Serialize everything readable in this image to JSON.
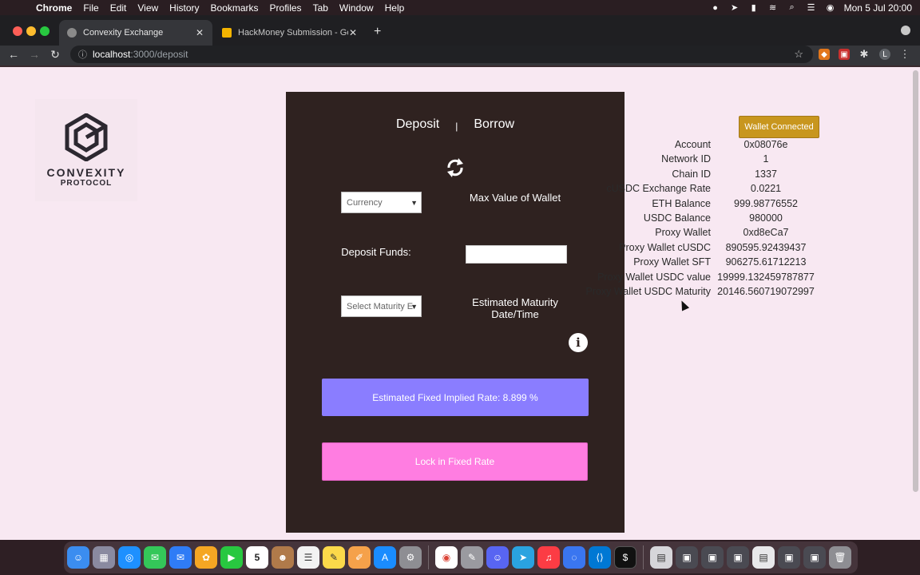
{
  "menubar": {
    "app": "Chrome",
    "items": [
      "File",
      "Edit",
      "View",
      "History",
      "Bookmarks",
      "Profiles",
      "Tab",
      "Window",
      "Help"
    ],
    "clock": "Mon 5 Jul  20:00"
  },
  "tabs": [
    {
      "title": "Convexity Exchange",
      "active": true
    },
    {
      "title": "HackMoney Submission - Goo",
      "active": false
    }
  ],
  "address": {
    "host": "localhost",
    "path": ":3000/deposit"
  },
  "logo": {
    "line1": "CONVEXITY",
    "line2": "PROTOCOL"
  },
  "panel": {
    "mode_deposit": "Deposit",
    "mode_sep": "|",
    "mode_borrow": "Borrow",
    "currency_select": "Currency",
    "max_value_label": "Max Value of Wallet",
    "deposit_funds_label": "Deposit Funds:",
    "deposit_input": "",
    "maturity_select": "Select Maturity E",
    "est_maturity_label_1": "Estimated Maturity",
    "est_maturity_label_2": "Date/Time",
    "rate_text": "Estimated Fixed Implied Rate: 8.899 %",
    "lock_button": "Lock in Fixed Rate"
  },
  "wallet": {
    "button": "Wallet Connected",
    "rows": [
      {
        "label": "Account",
        "value": "0x08076e"
      },
      {
        "label": "Network ID",
        "value": "1"
      },
      {
        "label": "Chain ID",
        "value": "1337"
      },
      {
        "label": "cUSDC Exchange Rate",
        "value": "0.0221"
      },
      {
        "label": "ETH Balance",
        "value": "999.98776552"
      },
      {
        "label": "USDC Balance",
        "value": "980000"
      },
      {
        "label": "Proxy Wallet",
        "value": "0xd8eCa7"
      },
      {
        "label": "Proxy Wallet cUSDC",
        "value": "890595.92439437"
      },
      {
        "label": "Proxy Wallet SFT",
        "value": "906275.61712213"
      },
      {
        "label": "Proxy Wallet USDC value",
        "value": "19999.132459787877"
      },
      {
        "label": "Proxy Wallet USDC Maturity",
        "value": "20146.560719072997"
      }
    ]
  },
  "colors": {
    "page_bg": "#f8e8f2",
    "panel_bg": "#2f2220",
    "rate_bar": "#8a7dff",
    "lock_button": "#ff7de1",
    "wallet_button": "#c8961e"
  },
  "dock": {
    "icons": [
      "finder-icon",
      "launchpad-icon",
      "safari-icon",
      "messages-icon",
      "mail-icon",
      "photos-icon",
      "facetime-icon",
      "calendar-icon",
      "contacts-icon",
      "reminders-icon",
      "notes-icon",
      "pages-icon",
      "app-store-icon",
      "system-preferences-icon",
      "chrome-icon",
      "script-editor-icon",
      "discord-icon",
      "telegram-icon",
      "music-icon",
      "signal-icon",
      "vscode-icon",
      "terminal-icon"
    ],
    "calendar_day": "5"
  }
}
